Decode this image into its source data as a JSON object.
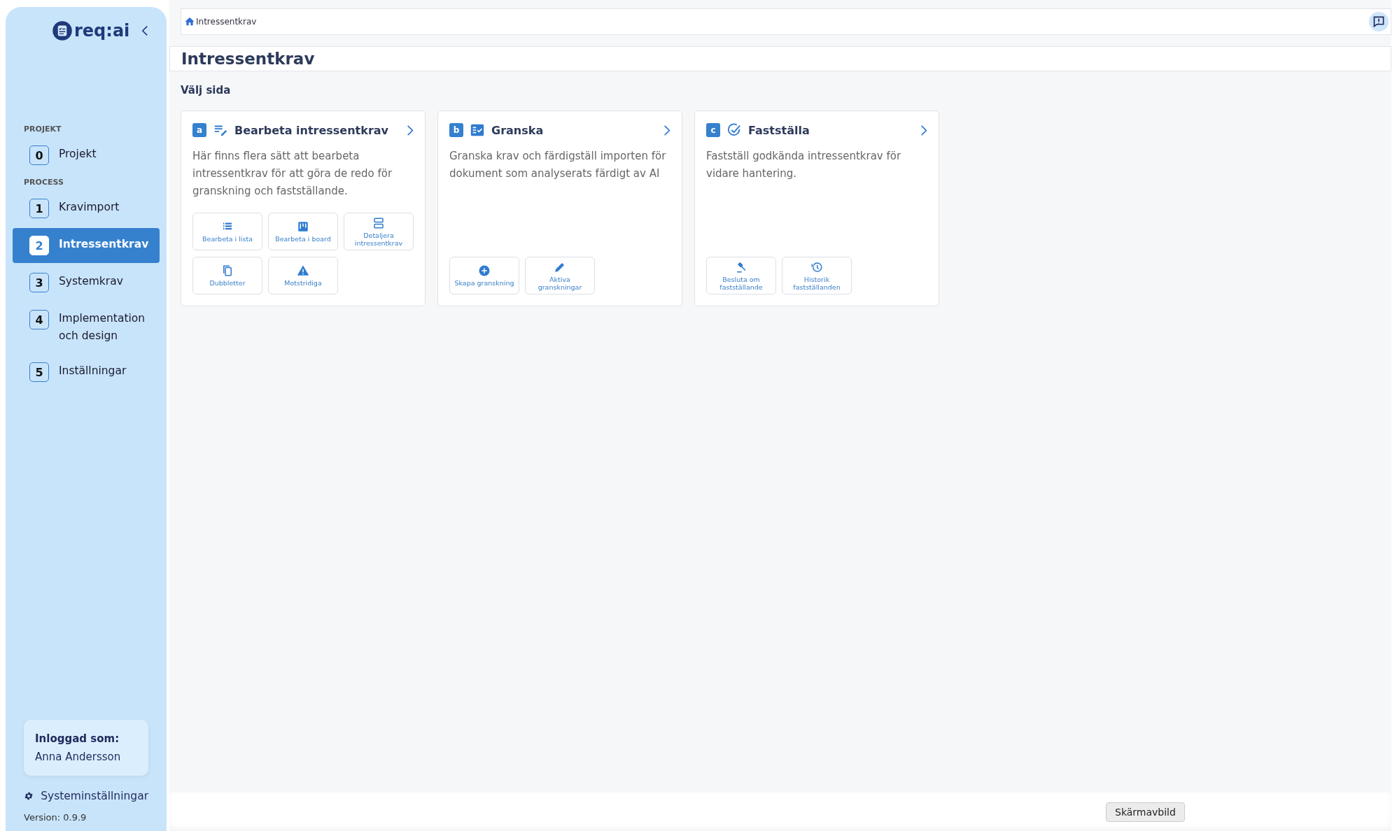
{
  "logo": {
    "text": "req:ai"
  },
  "sidebar": {
    "sections": [
      {
        "heading": "PROJEKT",
        "items": [
          {
            "number": "0",
            "label": "Projekt",
            "selected": false
          }
        ]
      },
      {
        "heading": "PROCESS",
        "items": [
          {
            "number": "1",
            "label": "Kravimport",
            "selected": false
          },
          {
            "number": "2",
            "label": "Intressentkrav",
            "selected": true
          },
          {
            "number": "3",
            "label": "Systemkrav",
            "selected": false
          },
          {
            "number": "4",
            "label": "Implementation och design",
            "selected": false
          },
          {
            "number": "5",
            "label": "Inställningar",
            "selected": false
          }
        ]
      }
    ],
    "user_card": {
      "label": "Inloggad som:",
      "name": "Anna Andersson"
    },
    "settings_link": "Systeminställningar",
    "version": "Version: 0.9.9"
  },
  "breadcrumb": "Intressentkrav",
  "page_title": "Intressentkrav",
  "section_heading": "Välj sida",
  "cards": [
    {
      "letter": "a",
      "title": "Bearbeta intressentkrav",
      "description": "Här finns flera sätt att bearbeta intressentkrav för att göra de redo för granskning och fastställande.",
      "actions": [
        "Bearbeta i lista",
        "Bearbeta i board",
        "Detaljera intressentkrav",
        "Dubbletter",
        "Motstridiga"
      ]
    },
    {
      "letter": "b",
      "title": "Granska",
      "description": "Granska krav och färdigställ importen för dokument som analyserats färdigt av AI",
      "actions": [
        "Skapa granskning",
        "Aktiva granskningar"
      ]
    },
    {
      "letter": "c",
      "title": "Fastställa",
      "description": "Fastställ godkända intressentkrav för vidare hantering.",
      "actions": [
        "Besluta om fastställande",
        "Historik fastställanden"
      ]
    }
  ],
  "tooltip": "Skärmavbild"
}
